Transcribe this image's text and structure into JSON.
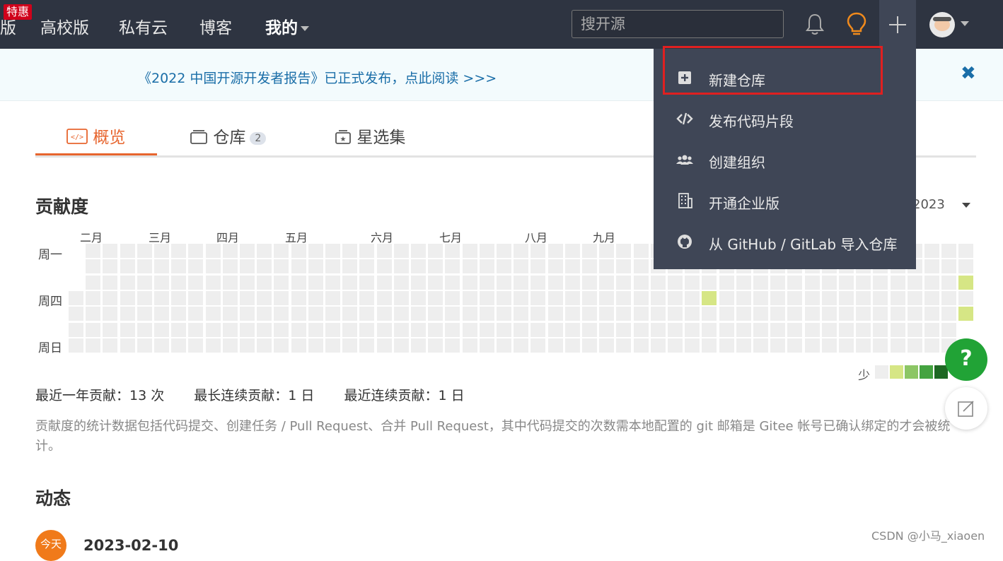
{
  "nav": {
    "hot_badge": "特惠",
    "clipped_item": "版",
    "items": [
      "高校版",
      "私有云",
      "博客",
      "我的"
    ],
    "search_placeholder": "搜开源"
  },
  "announcement": {
    "text": "《2022 中国开源开发者报告》已正式发布，点此阅读 >>>",
    "close": "✖"
  },
  "tabs": [
    {
      "label": "概览",
      "icon": "overview-icon"
    },
    {
      "label": "仓库",
      "count": "2",
      "icon": "repo-icon"
    },
    {
      "label": "星选集",
      "icon": "star-collection-icon"
    }
  ],
  "contribution": {
    "title": "贡献度",
    "year": "2023",
    "months": [
      "二月",
      "三月",
      "四月",
      "五月",
      "六月",
      "七月",
      "八月",
      "九月"
    ],
    "days": [
      "周一",
      "周四",
      "周日"
    ],
    "legend_less": "少",
    "legend_colors": [
      "#eeeeee",
      "#d6e685",
      "#8cc665",
      "#44a340",
      "#1e6823"
    ],
    "stats": [
      "最近一年贡献：13 次",
      "最长连续贡献：1 日",
      "最近连续贡献：1 日"
    ],
    "note": "贡献度的统计数据包括代码提交、创建任务 / Pull Request、合并 Pull Request，其中代码提交的次数需本地配置的 git 邮箱是 Gitee 帐号已确认绑定的才会被统计。"
  },
  "activity": {
    "title": "动态",
    "avatar_text": "今天",
    "date": "2023-02-10"
  },
  "help": "?",
  "watermark": "CSDN @小马_xiaoen",
  "menu": {
    "items": [
      {
        "label": "新建仓库",
        "icon": "plus-square-icon"
      },
      {
        "label": "发布代码片段",
        "icon": "code-icon"
      },
      {
        "label": "创建组织",
        "icon": "group-icon"
      },
      {
        "label": "开通企业版",
        "icon": "building-icon"
      },
      {
        "label": "从 GitHub / GitLab 导入仓库",
        "icon": "github-icon"
      }
    ]
  }
}
